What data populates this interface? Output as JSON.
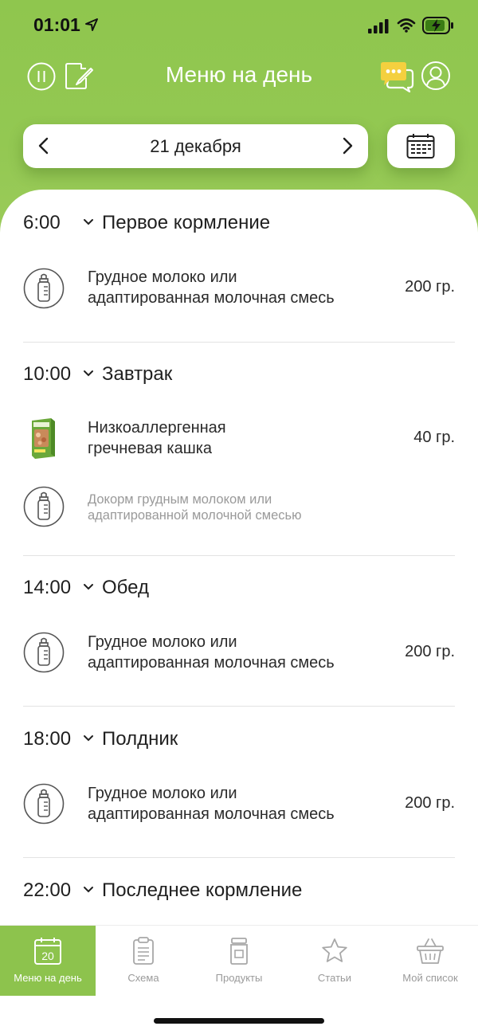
{
  "status": {
    "time": "01:01"
  },
  "header": {
    "title": "Меню на день"
  },
  "date": {
    "label": "21 декабря"
  },
  "meals": [
    {
      "time": "6:00",
      "name": "Первое кормление",
      "items": [
        {
          "line1": "Грудное молоко или",
          "line2": "адаптированная молочная смесь",
          "qty": "200 гр."
        }
      ]
    },
    {
      "time": "10:00",
      "name": "Завтрак",
      "items": [
        {
          "line1": "Низкоаллергенная",
          "line2": "гречневая кашка",
          "qty": "40 гр."
        },
        {
          "line1": "Докорм грудным молоком или",
          "line2": "адаптированной молочной смесью"
        }
      ]
    },
    {
      "time": "14:00",
      "name": "Обед",
      "items": [
        {
          "line1": "Грудное молоко или",
          "line2": "адаптированная молочная смесь",
          "qty": "200 гр."
        }
      ]
    },
    {
      "time": "18:00",
      "name": "Полдник",
      "items": [
        {
          "line1": "Грудное молоко или",
          "line2": "адаптированная молочная смесь",
          "qty": "200 гр."
        }
      ]
    },
    {
      "time": "22:00",
      "name": "Последнее кормление"
    }
  ],
  "tabs": [
    {
      "label": "Меню на день",
      "icon": "calendar-icon",
      "badge": "20",
      "active": true
    },
    {
      "label": "Схема",
      "icon": "clipboard-icon"
    },
    {
      "label": "Продукты",
      "icon": "jar-icon"
    },
    {
      "label": "Статьи",
      "icon": "star-icon"
    },
    {
      "label": "Мой список",
      "icon": "basket-icon"
    }
  ],
  "colors": {
    "accent": "#8dc34d",
    "text": "#1f1f1f",
    "muted": "#9a9a9a",
    "chat_icon": "#f4d03f"
  }
}
